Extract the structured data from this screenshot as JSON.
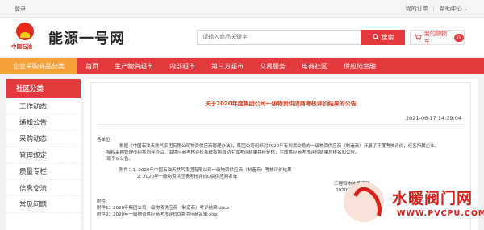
{
  "topbar": {
    "login": "登录",
    "links": [
      "我的订单",
      "帮助中心"
    ]
  },
  "header": {
    "logo_text": "中国石油",
    "site_title": "能源一号网",
    "search_placeholder": "请输入商品关键字",
    "search_button": "搜索",
    "cart_label": "我的购物车",
    "cart_count": "0"
  },
  "nav": {
    "category": "企业采购商品分类",
    "items": [
      "首页",
      "生产物资超市",
      "内部超市",
      "第三方超市",
      "交易服务",
      "电商社区",
      "供应链金融"
    ]
  },
  "sidebar": {
    "title": "社区分类",
    "items": [
      "工作动态",
      "通知公告",
      "采购动态",
      "管理规定",
      "质量专栏",
      "信息交流",
      "常见问题"
    ]
  },
  "article": {
    "title": "关于2020年度集团公司一级物资供应商考核评价结果的公告",
    "publish_time": "2021-06-17 14:39:04",
    "salutation": "各单位:",
    "paragraph_lines": [
      "根据《中国石油天然气集团有限公司物资供应商管理办法》，集团公司组织对2020年有到货交易的一级物资供应商（制造商）开展了年度考核评价，经各所属企业,",
      "授权采购管理小组共同评价后，由供应商考核评价系统按照自动生成考评结果并经复核，生成供应商考核评价结果总排名和公告。",
      "现予以公告。"
    ],
    "attachment_lines": [
      "附件：1. 2020年中国石油天然气集团有限公司一级物资供应商（制造商）考核评价结果",
      "2. 2020年一级物资供应商考核评价D类供应商名单"
    ],
    "signature": "工程和物装管理部",
    "sign_date": "2020年6月15日",
    "attachments_label": "附件:",
    "files": [
      "附件1：2020年集团公司一级物资供应商（制造商）考评结果.docx",
      "附件2：2020年一级物资供应商考核评价D类供应商名单.xlsx"
    ]
  },
  "watermark": {
    "brand": "水暖阀门网",
    "url": "WWW.PVCPU.COM"
  },
  "colors": {
    "primary_red": "#e4393c",
    "category_orange": "#f6a03c",
    "title_red": "#d63a1a"
  }
}
